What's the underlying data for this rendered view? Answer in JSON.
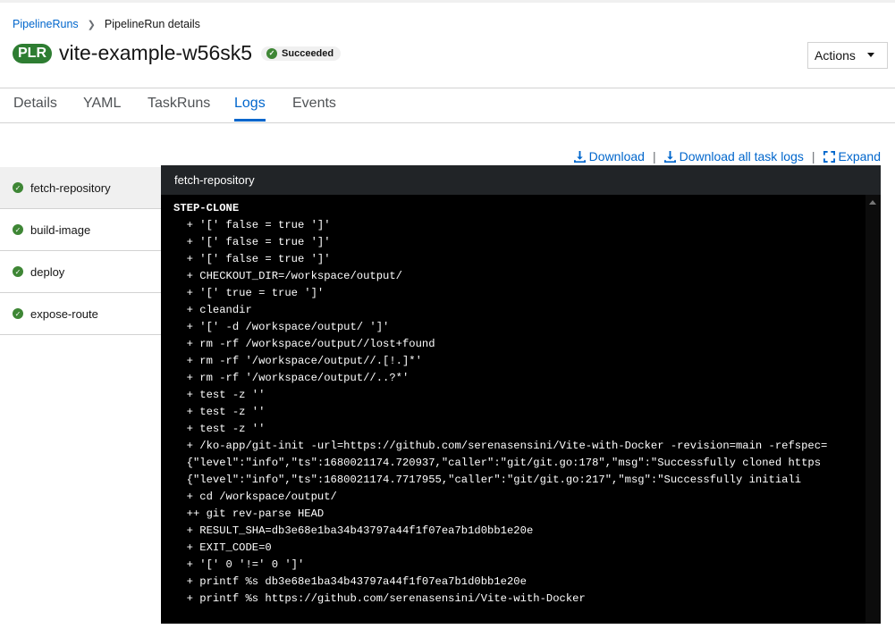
{
  "breadcrumb": {
    "root": "PipelineRuns",
    "current": "PipelineRun details"
  },
  "header": {
    "badge": "PLR",
    "title": "vite-example-w56sk5",
    "status": "Succeeded",
    "actions_label": "Actions"
  },
  "tabs": [
    "Details",
    "YAML",
    "TaskRuns",
    "Logs",
    "Events"
  ],
  "active_tab": "Logs",
  "toolbar": {
    "download": "Download",
    "download_all": "Download all task logs",
    "expand": "Expand"
  },
  "tasks": [
    "fetch-repository",
    "build-image",
    "deploy",
    "expose-route"
  ],
  "log": {
    "title": "fetch-repository",
    "lines": [
      "STEP-CLONE",
      "  + '[' false = true ']'",
      "  + '[' false = true ']'",
      "  + '[' false = true ']'",
      "  + CHECKOUT_DIR=/workspace/output/",
      "  + '[' true = true ']'",
      "  + cleandir",
      "  + '[' -d /workspace/output/ ']'",
      "  + rm -rf /workspace/output//lost+found",
      "  + rm -rf '/workspace/output//.[!.]*'",
      "  + rm -rf '/workspace/output//..?*'",
      "  + test -z ''",
      "  + test -z ''",
      "  + test -z ''",
      "  + /ko-app/git-init -url=https://github.com/serenasensini/Vite-with-Docker -revision=main -refspec=",
      "  {\"level\":\"info\",\"ts\":1680021174.720937,\"caller\":\"git/git.go:178\",\"msg\":\"Successfully cloned https",
      "  {\"level\":\"info\",\"ts\":1680021174.7717955,\"caller\":\"git/git.go:217\",\"msg\":\"Successfully initiali",
      "  + cd /workspace/output/",
      "  ++ git rev-parse HEAD",
      "  + RESULT_SHA=db3e68e1ba34b43797a44f1f07ea7b1d0bb1e20e",
      "  + EXIT_CODE=0",
      "  + '[' 0 '!=' 0 ']'",
      "  + printf %s db3e68e1ba34b43797a44f1f07ea7b1d0bb1e20e",
      "  + printf %s https://github.com/serenasensini/Vite-with-Docker"
    ]
  },
  "colors": {
    "link": "#0066cc",
    "success": "#3e8635",
    "plr_badge": "#2e7d32"
  }
}
